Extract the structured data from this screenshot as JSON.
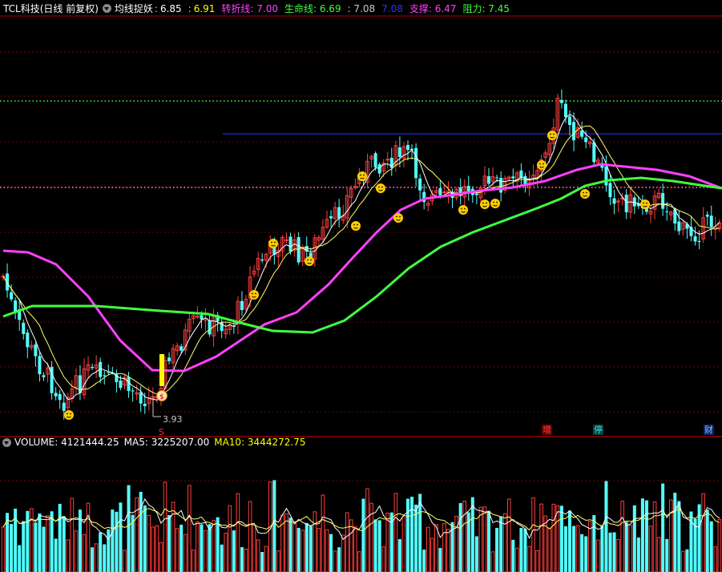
{
  "header": {
    "title": "TCL科技(日线 前复权)",
    "indicator_name": "均线捉妖",
    "values": [
      {
        "text": ":",
        "color": "#c8c8c8"
      },
      {
        "text": "6.85",
        "color": "#ffffff"
      },
      {
        "text": ":",
        "color": "#c8c8c8"
      },
      {
        "text": "6.91",
        "color": "#ffff00"
      },
      {
        "text": "转折线: 7.00",
        "color": "#ff40ff"
      },
      {
        "text": "生命线: 6.69",
        "color": "#40ff40"
      },
      {
        "text": ": 7.08",
        "color": "#c8c8c8"
      },
      {
        "text": "7.08",
        "color": "#3030ff"
      },
      {
        "text": "支撑: 6.47",
        "color": "#ff40ff"
      },
      {
        "text": "阻力: 7.45",
        "color": "#40ff40"
      }
    ]
  },
  "volume_header": {
    "volume": "VOLUME: 4121444.25",
    "ma5": "MA5: 3225207.00",
    "ma10": "MA10: 3444272.75"
  },
  "low_label": "3.93",
  "markers": {
    "buy_signal": "S"
  },
  "badges": [
    {
      "text": "增",
      "color": "#ff4040",
      "bg": "#600000"
    },
    {
      "text": "停",
      "color": "#40e0e0",
      "bg": "#004040"
    },
    {
      "text": "财",
      "color": "#80c0ff",
      "bg": "#102060"
    }
  ],
  "colors": {
    "up": "#ff3c3c",
    "down": "#54ffff",
    "ma5": "#ffffff",
    "ma10": "#ffff64",
    "turn_line": "#ff40ff",
    "life_line": "#40ff40",
    "support_line": "#2020ff",
    "grid": "#7a0000",
    "axis_border": "#b00000"
  }
}
